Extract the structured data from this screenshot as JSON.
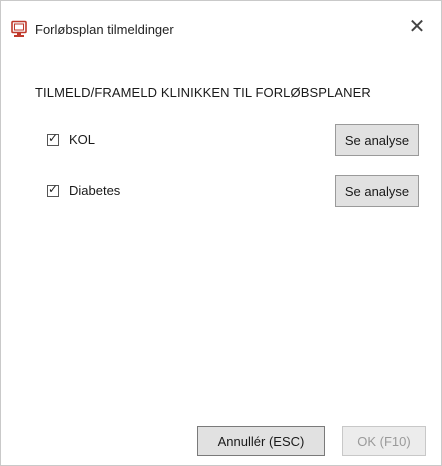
{
  "window": {
    "title": "Forløbsplan tilmeldinger",
    "close_glyph": "✕",
    "icon": "monitor-icon"
  },
  "main": {
    "heading": "TILMELD/FRAMELD KLINIKKEN TIL FORLØBSPLANER",
    "items": [
      {
        "label": "KOL",
        "checked": true,
        "button_label": "Se analyse"
      },
      {
        "label": "Diabetes",
        "checked": true,
        "button_label": "Se analyse"
      }
    ]
  },
  "footer": {
    "cancel_label": "Annullér (ESC)",
    "ok_label": "OK (F10)",
    "ok_enabled": false
  },
  "colors": {
    "button_face": "#e1e1e1",
    "disabled_text": "#9a9a9a",
    "icon_red": "#c0392b"
  }
}
